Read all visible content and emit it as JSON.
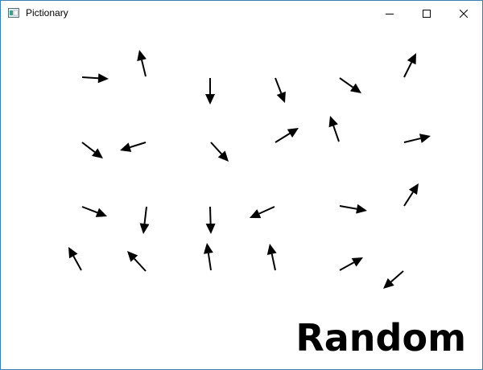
{
  "window": {
    "title": "Pictionary",
    "controls": [
      "minimize-icon",
      "maximize-icon",
      "close-icon"
    ]
  },
  "canvas": {
    "word": "Random",
    "arrow_color": "#000000",
    "arrow_count": 24
  }
}
